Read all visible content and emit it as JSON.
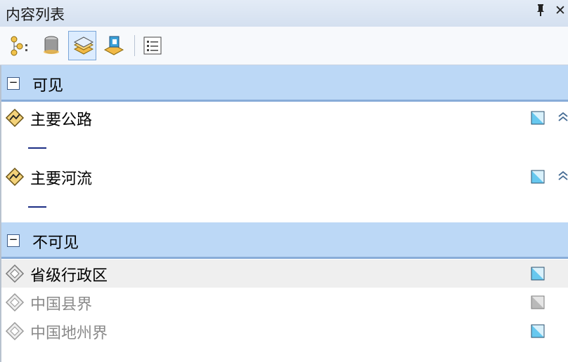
{
  "window": {
    "title": "内容列表",
    "pin_glyph": "ᚒ",
    "close_glyph": "✕"
  },
  "toolbar": {
    "buttons": [
      {
        "name": "list-by-drawing-order-icon"
      },
      {
        "name": "list-by-source-icon"
      },
      {
        "name": "list-by-visibility-icon",
        "active": true
      },
      {
        "name": "list-by-selection-icon"
      },
      {
        "name": "options-icon"
      }
    ]
  },
  "groups": [
    {
      "label": "可见",
      "toggle": "−",
      "layers": [
        {
          "name": "主要公路",
          "visible": true,
          "dimmed": false
        },
        {
          "name": "主要河流",
          "visible": true,
          "dimmed": false
        }
      ]
    },
    {
      "label": "不可见",
      "toggle": "−",
      "layers": [
        {
          "name": "省级行政区",
          "visible": true,
          "dimmed": false,
          "selected": true
        },
        {
          "name": "中国县界",
          "visible": false,
          "dimmed": true
        },
        {
          "name": "中国地州界",
          "visible": true,
          "dimmed": true
        }
      ]
    }
  ],
  "colors": {
    "group_header": "#bcd8f6",
    "legend_line": "#1c2e84",
    "accent": "#7aa5d8"
  }
}
